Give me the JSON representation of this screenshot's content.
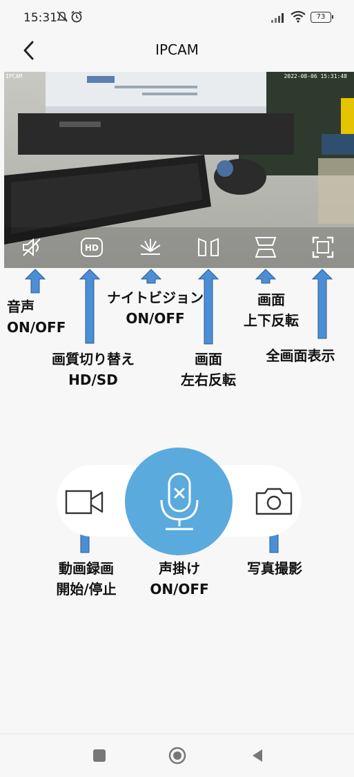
{
  "status_bar": {
    "time": "15:31",
    "icons": [
      "mute-notification-icon",
      "alarm-icon",
      "signal-icon",
      "wifi-icon",
      "battery-icon"
    ],
    "battery": "73"
  },
  "header": {
    "title": "IPCAM",
    "back_icon": "chevron-left-icon"
  },
  "video": {
    "label": "IPCAM",
    "timestamp": "2022-08-06 15:31:48",
    "controls": [
      "sound-off-icon",
      "hd-icon",
      "night-vision-icon",
      "flip-horizontal-icon",
      "flip-vertical-icon",
      "fullscreen-icon"
    ]
  },
  "annotations": {
    "sound": [
      "音声",
      "ON/OFF"
    ],
    "quality": [
      "画質切り替え",
      "HD/SD"
    ],
    "night": [
      "ナイトビジョン",
      "ON/OFF"
    ],
    "flip_h": [
      "画面",
      "左右反転"
    ],
    "flip_v": [
      "画面",
      "上下反転"
    ],
    "fullscreen": [
      "全画面表示"
    ],
    "record": [
      "動画録画",
      "開始/停止"
    ],
    "talk": [
      "声掛け",
      "ON/OFF"
    ],
    "photo": [
      "写真撮影"
    ]
  },
  "bottom_controls": {
    "record_icon": "video-camera-icon",
    "talk_icon": "microphone-icon",
    "photo_icon": "camera-icon"
  },
  "colors": {
    "accent": "#5aaadd",
    "arrow": "#4a8fd6"
  },
  "nav_bar": {
    "icons": [
      "square-icon",
      "circle-home-icon",
      "triangle-back-icon"
    ]
  }
}
